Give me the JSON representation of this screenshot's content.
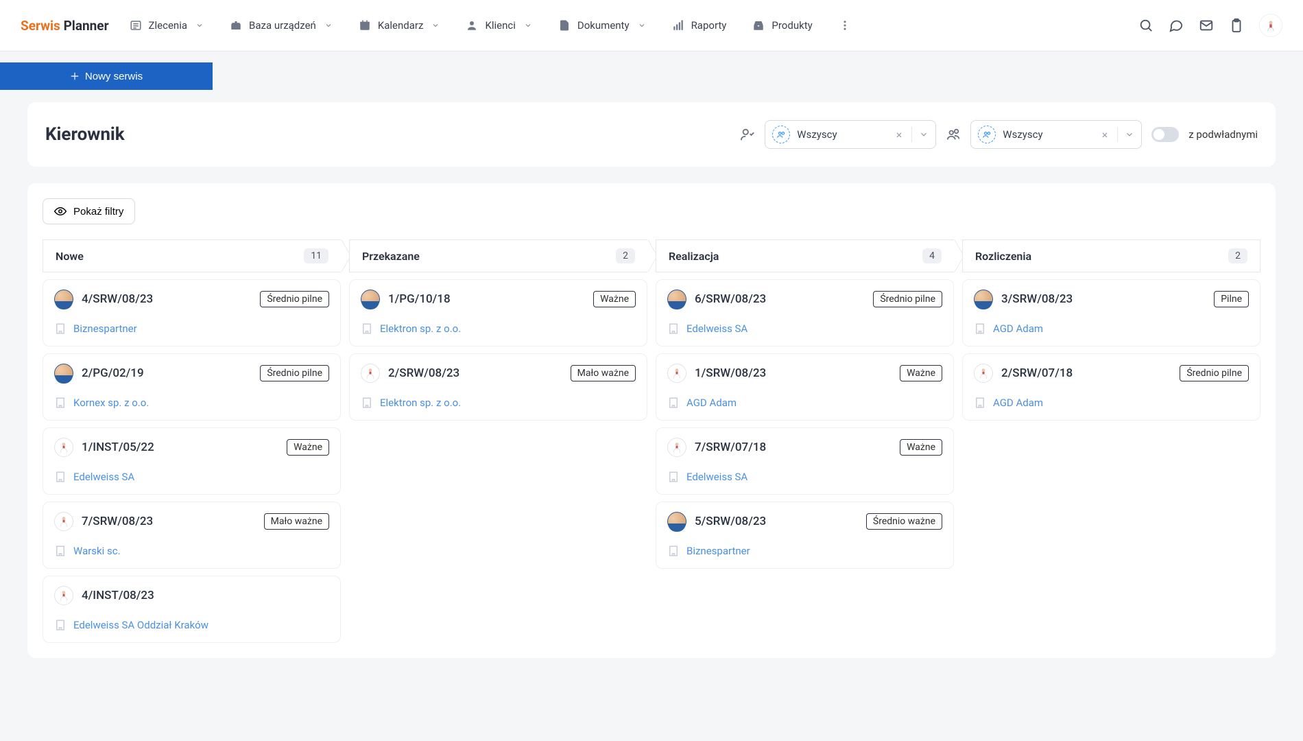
{
  "logo": {
    "part1": "Serwis",
    "part2": "Planner"
  },
  "nav": {
    "zlecenia": "Zlecenia",
    "baza": "Baza urządzeń",
    "kalendarz": "Kalendarz",
    "klienci": "Klienci",
    "dokumenty": "Dokumenty",
    "raporty": "Raporty",
    "produkty": "Produkty"
  },
  "new_service": "Nowy serwis",
  "page_title": "Kierownik",
  "filter_select1": "Wszyscy",
  "filter_select2": "Wszyscy",
  "with_subordinates": "z podwładnymi",
  "show_filters": "Pokaż filtry",
  "columns": [
    {
      "title": "Nowe",
      "count": "11",
      "cards": [
        {
          "avatar": "A",
          "code": "4/SRW/08/23",
          "badge": "Średnio pilne",
          "client": "Biznespartner"
        },
        {
          "avatar": "A",
          "code": "2/PG/02/19",
          "badge": "Średnio pilne",
          "client": "Kornex sp. z o.o."
        },
        {
          "avatar": "B",
          "code": "1/INST/05/22",
          "badge": "Ważne",
          "client": "Edelweiss SA"
        },
        {
          "avatar": "B",
          "code": "7/SRW/08/23",
          "badge": "Mało ważne",
          "client": "Warski sc."
        },
        {
          "avatar": "B",
          "code": "4/INST/08/23",
          "badge": "",
          "client": "Edelweiss SA Oddział Kraków"
        }
      ]
    },
    {
      "title": "Przekazane",
      "count": "2",
      "cards": [
        {
          "avatar": "A",
          "code": "1/PG/10/18",
          "badge": "Ważne",
          "client": "Elektron sp. z o.o."
        },
        {
          "avatar": "B",
          "code": "2/SRW/08/23",
          "badge": "Mało ważne",
          "client": "Elektron sp. z o.o."
        }
      ]
    },
    {
      "title": "Realizacja",
      "count": "4",
      "cards": [
        {
          "avatar": "A",
          "code": "6/SRW/08/23",
          "badge": "Średnio pilne",
          "client": "Edelweiss SA"
        },
        {
          "avatar": "B",
          "code": "1/SRW/08/23",
          "badge": "Ważne",
          "client": "AGD Adam"
        },
        {
          "avatar": "B",
          "code": "7/SRW/07/18",
          "badge": "Ważne",
          "client": "Edelweiss SA"
        },
        {
          "avatar": "A",
          "code": "5/SRW/08/23",
          "badge": "Średnio ważne",
          "client": "Biznespartner"
        }
      ]
    },
    {
      "title": "Rozliczenia",
      "count": "2",
      "cards": [
        {
          "avatar": "A",
          "code": "3/SRW/08/23",
          "badge": "Pilne",
          "client": "AGD Adam"
        },
        {
          "avatar": "B",
          "code": "2/SRW/07/18",
          "badge": "Średnio pilne",
          "client": "AGD Adam"
        }
      ]
    }
  ]
}
